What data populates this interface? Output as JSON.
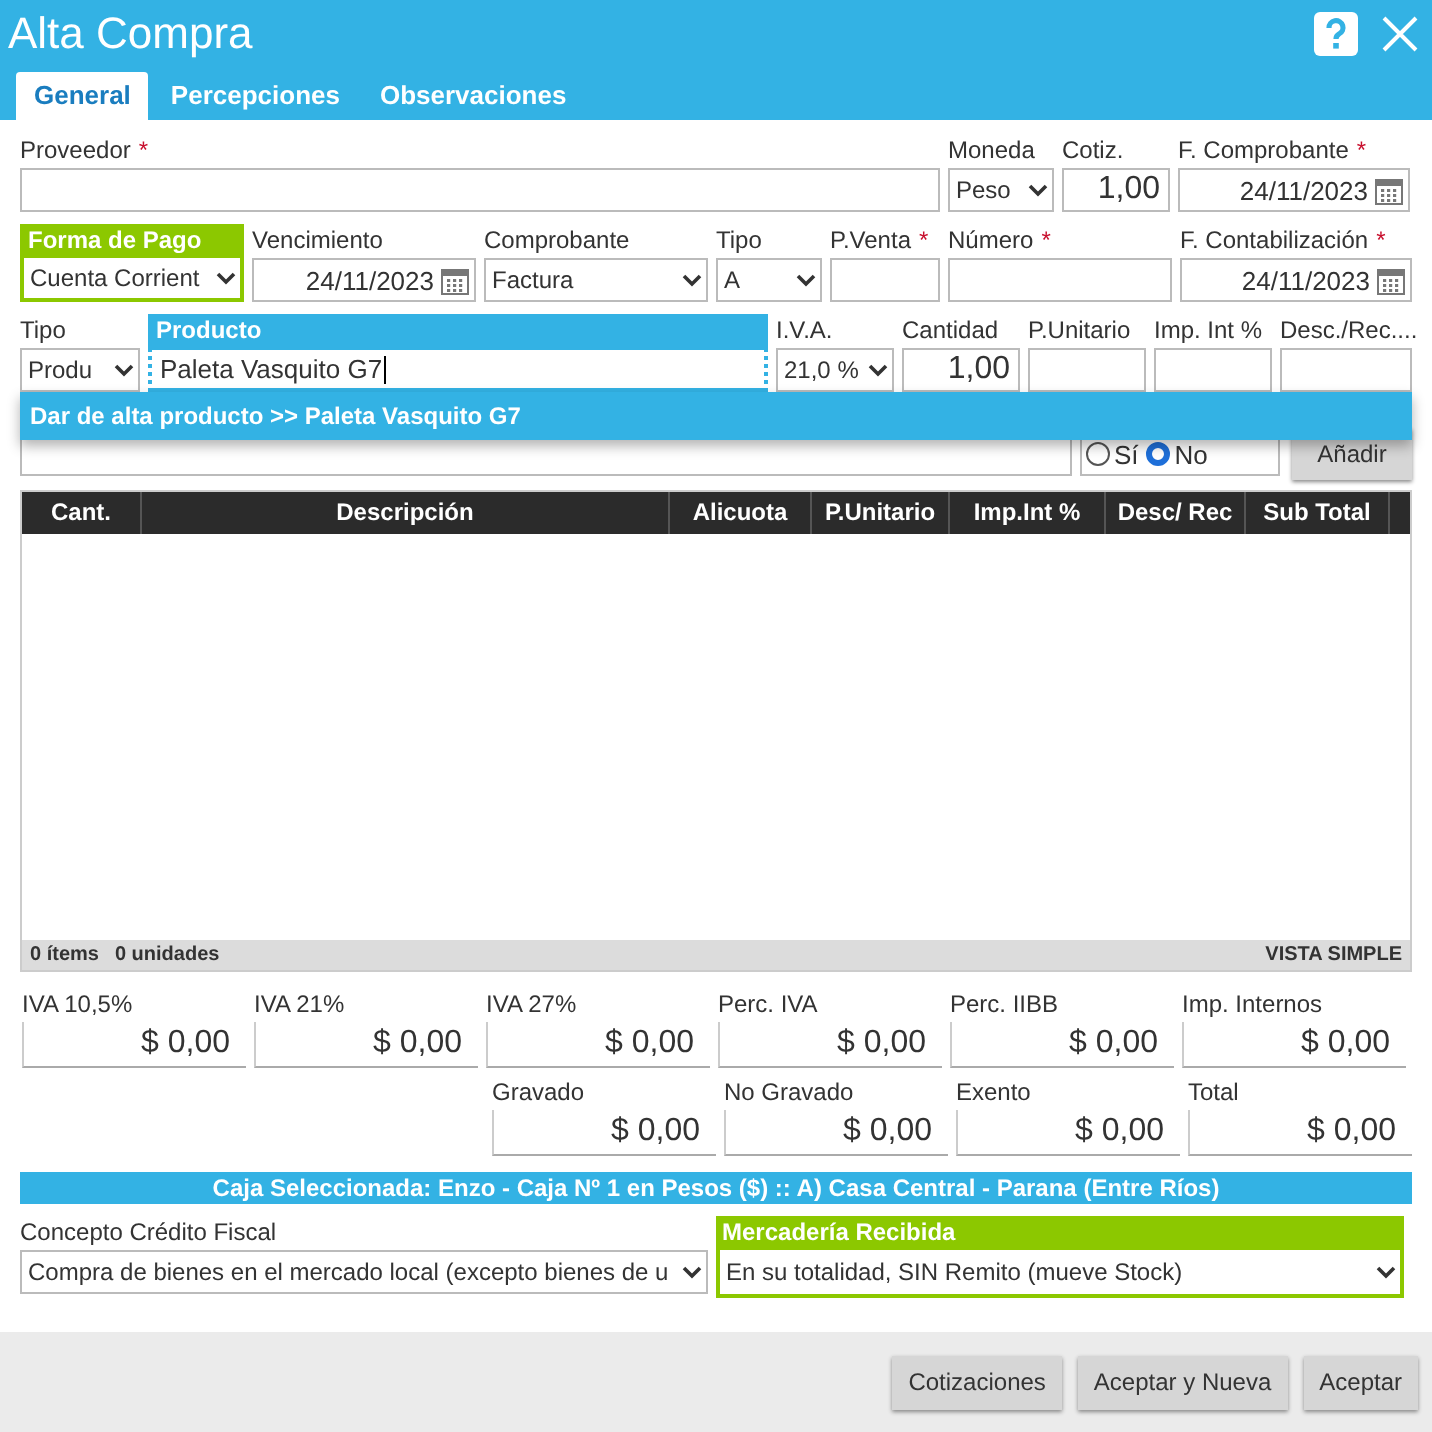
{
  "window": {
    "title": "Alta Compra"
  },
  "tabs": [
    {
      "label": "General",
      "selected": true
    },
    {
      "label": "Percepciones",
      "selected": false
    },
    {
      "label": "Observaciones",
      "selected": false
    }
  ],
  "rows": [
    [
      {
        "label": "Proveedor",
        "marker": "*",
        "kind": "input"
      },
      {
        "label": "Moneda",
        "kind": "select",
        "value": "Peso"
      },
      {
        "label": "Cotiz.",
        "kind": "number",
        "value": "1,00"
      },
      {
        "label": "F. Comprobante",
        "marker": "*",
        "kind": "date",
        "value": "24/11/2023"
      }
    ],
    [
      {
        "label": "Forma de Pago",
        "kind": "select",
        "value": "Cuenta Corrient",
        "color": "#8cc800"
      },
      {
        "label": "Vencimiento",
        "kind": "date",
        "value": "24/11/2023"
      },
      {
        "label": "Comprobante",
        "kind": "select",
        "value": "Factura"
      },
      {
        "label": "Tipo",
        "kind": "select",
        "value": "A"
      },
      {
        "label": "P.Venta",
        "marker": "*",
        "kind": "input"
      },
      {
        "label": "Número",
        "marker": "*",
        "kind": "input"
      },
      {
        "label": "F. Contabilización",
        "marker": "*",
        "kind": "date",
        "value": "24/11/2023"
      }
    ],
    [
      {
        "label": "Tipo",
        "kind": "select",
        "value": "Produ"
      },
      {
        "label": "Producto",
        "kind": "active",
        "value": "Paleta Vasquito G7",
        "color": "#33b2e4"
      },
      {
        "label": "I.V.A.",
        "kind": "select",
        "value": "21,0 %"
      },
      {
        "label": "Cantidad",
        "kind": "number",
        "value": "1,00"
      },
      {
        "label": "P.Unitario",
        "kind": "input"
      },
      {
        "label": "Imp. Int %",
        "kind": "input"
      },
      {
        "label": "Desc./Rec....",
        "kind": "input"
      }
    ]
  ],
  "suggestion": "Dar de alta producto >> Paleta Vasquito G7",
  "radio_options": [
    {
      "label": "Sí",
      "selected": false
    },
    {
      "label": "No",
      "selected": true
    }
  ],
  "add_button": "Añadir",
  "table": {
    "columns": [
      "Cant.",
      "Descripción",
      "Alicuota",
      "P.Unitario",
      "Imp.Int %",
      "Desc/ Rec",
      "Sub Total"
    ],
    "items_count": "0 ítems",
    "units_count": "0 unidades",
    "view_mode": "VISTA SIMPLE"
  },
  "totals": [
    [
      {
        "label": "IVA 10,5%",
        "value": "$ 0,00"
      },
      {
        "label": "IVA 21%",
        "value": "$ 0,00"
      },
      {
        "label": "IVA 27%",
        "value": "$ 0,00"
      },
      {
        "label": "Perc. IVA",
        "value": "$ 0,00"
      },
      {
        "label": "Perc. IIBB",
        "value": "$ 0,00"
      },
      {
        "label": "Imp. Internos",
        "value": "$ 0,00"
      }
    ],
    [
      {
        "label": "Gravado",
        "value": "$ 0,00"
      },
      {
        "label": "No Gravado",
        "value": "$ 0,00"
      },
      {
        "label": "Exento",
        "value": "$ 0,00"
      },
      {
        "label": "Total",
        "value": "$ 0,00"
      }
    ]
  ],
  "cash_register": "Caja Seleccionada: Enzo - Caja Nº 1 en Pesos ($) :: A) Casa Central - Parana (Entre Ríos)",
  "tax_credit": {
    "label": "Concepto Crédito Fiscal",
    "value": "Compra de bienes en el mercado local (excepto bienes de u"
  },
  "goods_received": {
    "label": "Mercadería Recibida",
    "value": "En su totalidad, SIN Remito (mueve Stock)",
    "color": "#8cc800"
  },
  "buttons": [
    "Cotizaciones",
    "Aceptar y Nueva",
    "Aceptar"
  ]
}
